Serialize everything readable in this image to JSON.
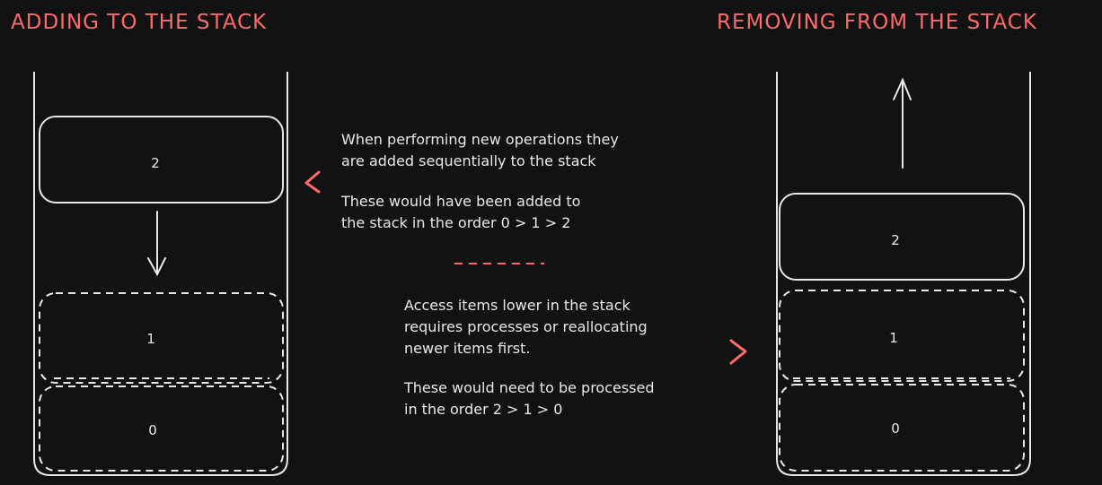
{
  "titles": {
    "left": "ADDING TO THE STACK",
    "right": "REMOVING FROM THE STACK"
  },
  "colors": {
    "background": "#121212",
    "stroke": "#e8e8e8",
    "accent": "#ff6b6b"
  },
  "left_stack": {
    "items": [
      "2",
      "1",
      "0"
    ]
  },
  "right_stack": {
    "items": [
      "2",
      "1",
      "0"
    ]
  },
  "notes": {
    "adding_1_line1": "When performing new operations they",
    "adding_1_line2": "are added sequentially to the stack",
    "adding_2_line1": "These would have been added to",
    "adding_2_line2": "the stack in the order 0 > 1 > 2",
    "removing_1_line1": "Access items lower in the stack",
    "removing_1_line2": "requires processes or reallocating",
    "removing_1_line3": "newer items first.",
    "removing_2_line1": "These would need to be processed",
    "removing_2_line2": "in the order 2 > 1 > 0"
  },
  "icons": {
    "left_pointer": "chevron-left-icon",
    "right_pointer": "chevron-right-icon",
    "down_arrow": "arrow-down-icon",
    "up_arrow": "arrow-up-icon"
  }
}
